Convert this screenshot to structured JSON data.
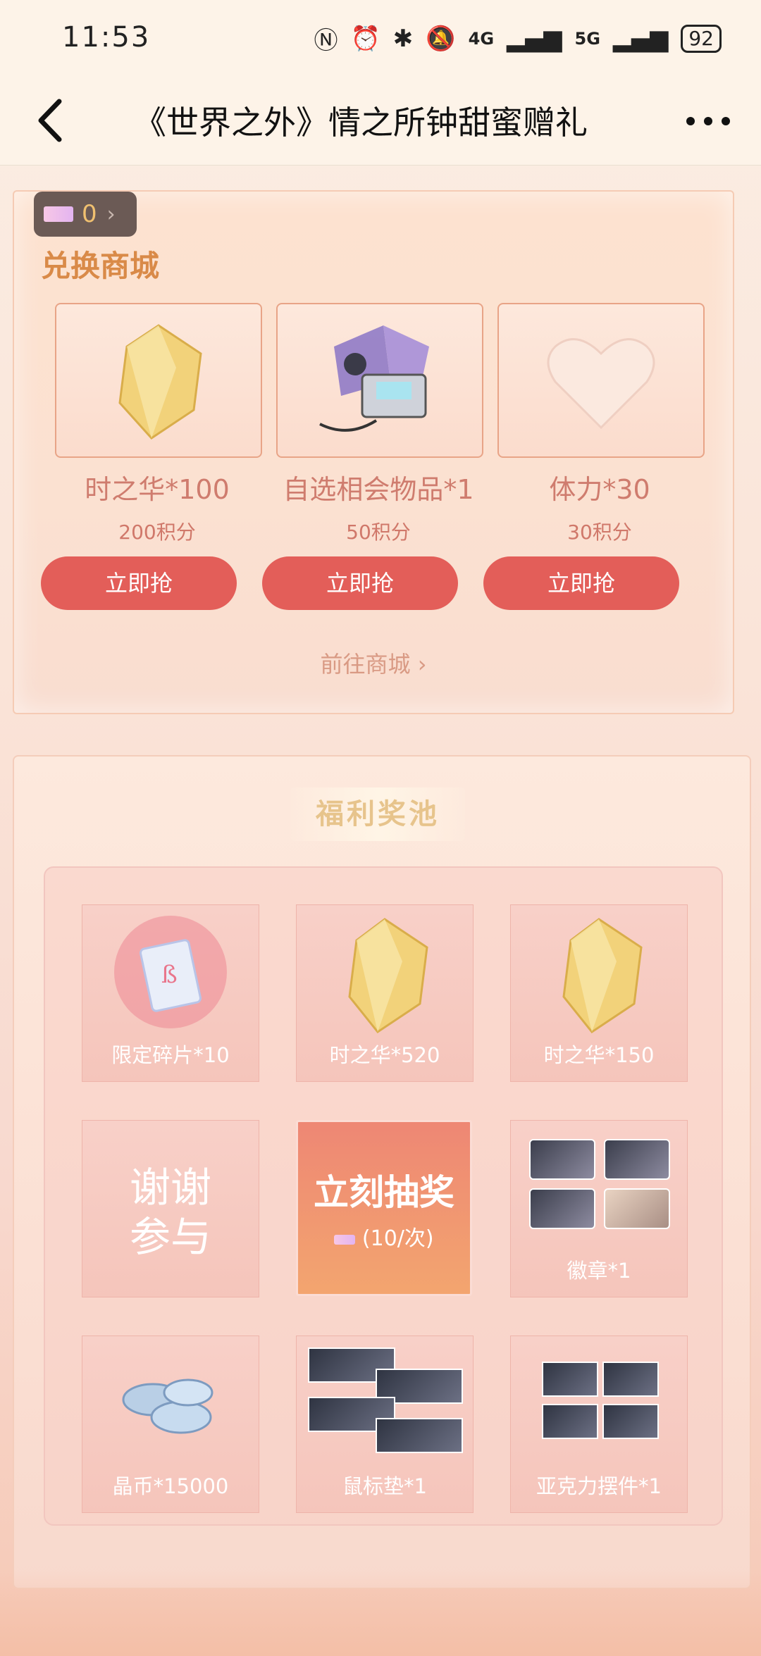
{
  "status_bar": {
    "time": "11:53",
    "net1": "4G",
    "net2": "5G",
    "battery": "92"
  },
  "nav": {
    "title": "《世界之外》情之所钟甜蜜赠礼"
  },
  "exchange": {
    "points": "0",
    "title": "兑换商城",
    "items": [
      {
        "name": "时之华*100",
        "cost": "200积分",
        "button": "立即抢",
        "icon": "gold-crystal-icon"
      },
      {
        "name": "自选相会物品*1",
        "cost": "50积分",
        "button": "立即抢",
        "icon": "gift-box-icon"
      },
      {
        "name": "体力*30",
        "cost": "30积分",
        "button": "立即抢",
        "icon": "heart-crystal-icon"
      }
    ],
    "goto_mall": "前往商城"
  },
  "pool": {
    "title": "福利奖池",
    "prizes": [
      {
        "label": "限定碎片*10",
        "icon": "fragment-card-icon"
      },
      {
        "label": "时之华*520",
        "icon": "gold-crystal-icon"
      },
      {
        "label": "时之华*150",
        "icon": "gold-crystal-icon"
      },
      {
        "label": "谢谢参与"
      },
      {
        "label": "徽章*1",
        "icon": "badge-icon"
      },
      {
        "label": "晶币*15000",
        "icon": "coins-icon"
      },
      {
        "label": "鼠标垫*1",
        "icon": "mousepad-icon"
      },
      {
        "label": "亚克力摆件*1",
        "icon": "acrylic-stand-icon"
      }
    ],
    "thanks_line1": "谢谢",
    "thanks_line2": "参与",
    "draw_label": "立刻抽奖",
    "draw_cost": "(10/次)"
  },
  "colors": {
    "button": "#e35e59",
    "accent": "#d98a48"
  }
}
